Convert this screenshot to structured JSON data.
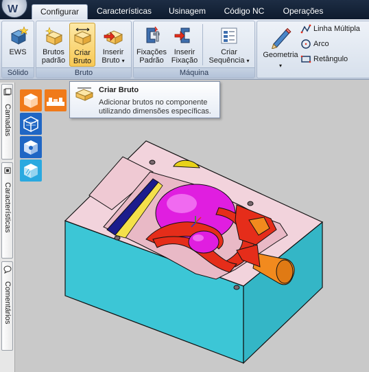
{
  "app": {
    "logo_text": "W"
  },
  "tabs": [
    {
      "label": "Configurar",
      "active": true
    },
    {
      "label": "Características",
      "active": false
    },
    {
      "label": "Usinagem",
      "active": false
    },
    {
      "label": "Código NC",
      "active": false
    },
    {
      "label": "Operações",
      "active": false
    }
  ],
  "ribbon": {
    "groups": [
      {
        "label": "Sólido"
      },
      {
        "label": "Bruto"
      },
      {
        "label": "Máquina"
      }
    ],
    "buttons": {
      "ews": {
        "line1": "EWS"
      },
      "brutos_padrao": {
        "line1": "Brutos",
        "line2": "padrão"
      },
      "criar_bruto": {
        "line1": "Criar",
        "line2": "Bruto"
      },
      "inserir_bruto": {
        "line1": "Inserir",
        "line2": "Bruto"
      },
      "fixacoes_padrao": {
        "line1": "Fixações",
        "line2": "Padrão"
      },
      "inserir_fixacao": {
        "line1": "Inserir",
        "line2": "Fixação"
      },
      "criar_sequencia": {
        "line1": "Criar",
        "line2": "Sequência"
      },
      "geometria": {
        "line1": "Geometria"
      }
    },
    "geometry_tools": [
      {
        "label": "Linha Múltipla",
        "icon": "polyline-icon"
      },
      {
        "label": "Arco",
        "icon": "arc-icon"
      },
      {
        "label": "Retângulo",
        "icon": "rectangle-icon"
      }
    ],
    "dropdown_glyph": "▾"
  },
  "sidepanel": {
    "tabs": [
      {
        "label": "Camadas"
      },
      {
        "label": "Características"
      },
      {
        "label": "Comentários"
      }
    ]
  },
  "tooltip": {
    "title": "Criar Bruto",
    "description": "Adicionar brutos no componente utilizando dimensões específicas."
  },
  "colors": {
    "part_side": "#3cc6d6",
    "part_top": "#f2d3dc",
    "pocket_magenta": "#e01ee0",
    "feature_red": "#e52d1a",
    "feature_orange": "#f28a1e",
    "feature_yellow": "#e8d21a",
    "feature_navy": "#1c1c8c",
    "highlight_button": "#f8c955"
  }
}
